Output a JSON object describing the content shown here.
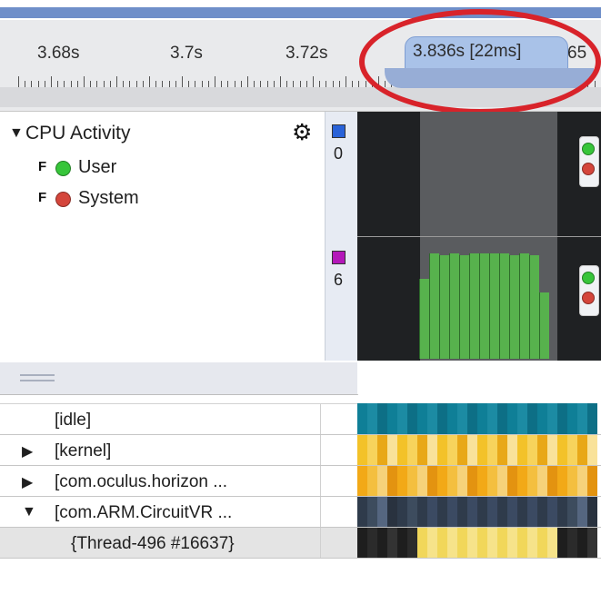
{
  "ruler": {
    "ticks": [
      "3.68s",
      "3.7s",
      "3.72s"
    ],
    "partial_label": "65",
    "selection_label": "3.836s [22ms]"
  },
  "cpu_panel": {
    "title": "CPU Activity",
    "items": [
      {
        "flag": "F",
        "label": "User",
        "color": "#37c53a"
      },
      {
        "flag": "F",
        "label": "System",
        "color": "#d4453b"
      }
    ],
    "gear_icon": "gear-icon",
    "scales": [
      {
        "value": "0",
        "color": "#2962d8"
      },
      {
        "value": "6",
        "color": "#b417b9"
      }
    ]
  },
  "timeline": {
    "colors": {
      "background": "#1f2123",
      "selection": "#5a5c5f",
      "user_bar": "#57b24d"
    },
    "user_bars": [
      0.68,
      0.89,
      0.88,
      0.89,
      0.88,
      0.89,
      0.89,
      0.89,
      0.89,
      0.88,
      0.89,
      0.88,
      0.56
    ]
  },
  "tree": {
    "rows": [
      {
        "label": "[idle]",
        "expanded": null
      },
      {
        "label": "[kernel]",
        "expanded": false
      },
      {
        "label": "[com.oculus.horizon ...",
        "expanded": false
      },
      {
        "label": "[com.ARM.CircuitVR ...",
        "expanded": true
      },
      {
        "label": "{Thread-496 #16637}",
        "expanded": null
      }
    ]
  }
}
